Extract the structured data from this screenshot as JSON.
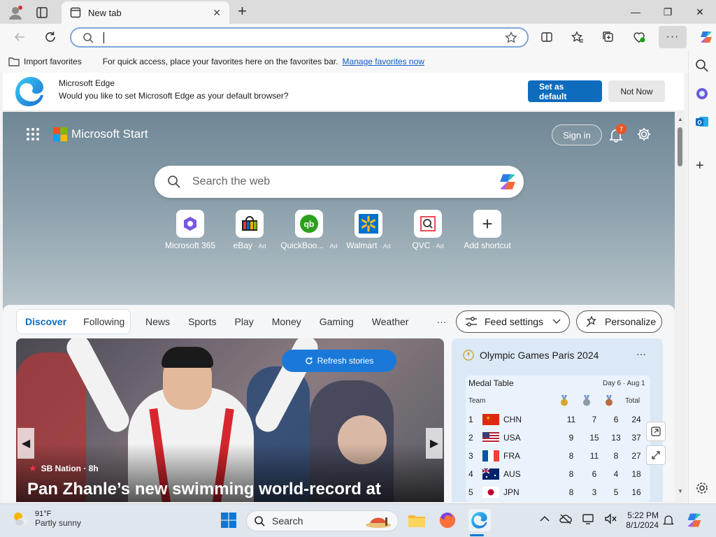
{
  "browser": {
    "tab_title": "New tab",
    "address_value": "",
    "favorites_bar": {
      "import_label": "Import favorites",
      "hint_text": "For quick access, place your favorites here on the favorites bar.",
      "manage_link": "Manage favorites now"
    },
    "default_banner": {
      "title": "Microsoft Edge",
      "message": "Would you like to set Microsoft Edge as your default browser?",
      "set_default_label": "Set as default",
      "not_now_label": "Not Now"
    }
  },
  "start_page": {
    "brand": "Microsoft Start",
    "sign_in_label": "Sign in",
    "notification_count": "7",
    "search_placeholder": "Search the web",
    "shortcuts": [
      {
        "label": "Microsoft 365",
        "ad": ""
      },
      {
        "label": "eBay",
        "ad": "· Ad"
      },
      {
        "label": "QuickBoo...",
        "ad": "· Ad"
      },
      {
        "label": "Walmart",
        "ad": "· Ad"
      },
      {
        "label": "QVC",
        "ad": "· Ad"
      },
      {
        "label": "Add shortcut",
        "ad": ""
      }
    ],
    "feed_tabs": {
      "discover": "Discover",
      "following": "Following",
      "news": "News",
      "sports": "Sports",
      "play": "Play",
      "money": "Money",
      "gaming": "Gaming",
      "weather": "Weather",
      "more": "···"
    },
    "feed_settings_label": "Feed settings",
    "personalize_label": "Personalize",
    "refresh_label": "Refresh stories",
    "hero": {
      "source": "SB Nation · 8h",
      "headline": "Pan Zhanle’s new swimming world-record at"
    },
    "olympics": {
      "title": "Olympic Games Paris 2024",
      "more": "···",
      "medal_table_label": "Medal Table",
      "day_label": "Day 6 · Aug 1",
      "team_header": "Team",
      "total_header": "Total",
      "rows": [
        {
          "rank": "1",
          "team": "CHN",
          "gold": "11",
          "silver": "7",
          "bronze": "6",
          "total": "24"
        },
        {
          "rank": "2",
          "team": "USA",
          "gold": "9",
          "silver": "15",
          "bronze": "13",
          "total": "37"
        },
        {
          "rank": "3",
          "team": "FRA",
          "gold": "8",
          "silver": "11",
          "bronze": "8",
          "total": "27"
        },
        {
          "rank": "4",
          "team": "AUS",
          "gold": "8",
          "silver": "6",
          "bronze": "4",
          "total": "18"
        },
        {
          "rank": "5",
          "team": "JPN",
          "gold": "8",
          "silver": "3",
          "bronze": "5",
          "total": "16"
        }
      ]
    }
  },
  "taskbar": {
    "weather_temp": "91°F",
    "weather_desc": "Partly sunny",
    "search_label": "Search",
    "time": "5:22 PM",
    "date": "8/1/2024"
  },
  "colors": {
    "accent": "#0f6cbd",
    "link": "#0f5cc0",
    "notification_badge": "#e8562a"
  }
}
